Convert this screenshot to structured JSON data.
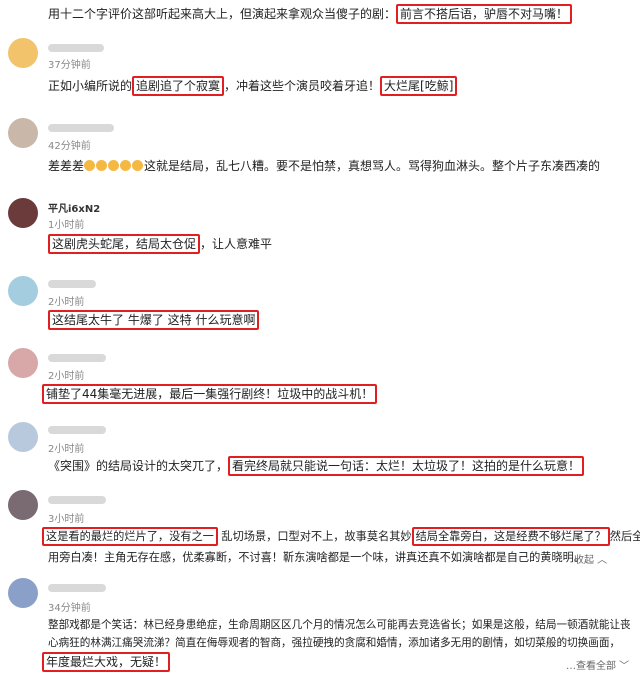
{
  "c0": {
    "text": "用十二个字评价这部听起来高大上，但演起来拿观众当傻子的剧：",
    "hl": "前言不搭后语，驴唇不对马嘴！"
  },
  "c1": {
    "time": "37分钟前",
    "pre": "正如小编所说的",
    "hl1": "追剧追了个寂寞",
    "mid": "，冲着这些个演员咬着牙追！",
    "hl2": "大烂尾[吃鲸]"
  },
  "c2": {
    "time": "42分钟前",
    "pre": "差差差",
    "post": "这就是结局，乱七八糟。要不是怕禁，真想骂人。骂得狗血淋头。整个片子东凑西凑的"
  },
  "c3": {
    "name": "平凡i6xN2",
    "time": "1小时前",
    "hl": "这剧虎头蛇尾，结局太仓促",
    "post": "，让人意难平"
  },
  "c4": {
    "time": "2小时前",
    "hl": "这结尾太牛了 牛爆了 这特   什么玩意啊"
  },
  "c5": {
    "time": "2小时前",
    "hl": "铺垫了44集毫无进展，最后一集强行剧终！垃圾中的战斗机！"
  },
  "c6": {
    "time": "2小时前",
    "pre": "《突围》的结局设计的太突兀了，",
    "hl": "看完终局就只能说一句话：太烂！太垃圾了！这拍的是什么玩意！"
  },
  "c7": {
    "time": "3小时前",
    "hl1": "这是看的最烂的烂片了，没有之一",
    "mid": "乱切场景，口型对不上，故事莫名其妙",
    "hl2": "结局全靠旁白，这是经费不够烂尾了？",
    "tail": "然后全",
    "line2": "用旁白凑！主角无存在感，优柔寡断，不讨喜！靳东演啥都是一个味，讲真还真不如演啥都是自己的黄晓明。",
    "collapse": "收起"
  },
  "c8": {
    "time": "34分钟前",
    "line1": "整部戏都是个笑话：林已经身患绝症，生命周期区区几个月的情况怎么可能再去竞选省长；如果是这般，结局一顿酒就能让丧",
    "line2": "心病狂的林满江痛哭流涕？简直在侮辱观者的智商，强拉硬拽的贪腐和婚情，添加诸多无用的剧情，如切菜般的切换画面，",
    "hl": "年度最烂大戏，无疑！",
    "more": "…查看全部"
  }
}
